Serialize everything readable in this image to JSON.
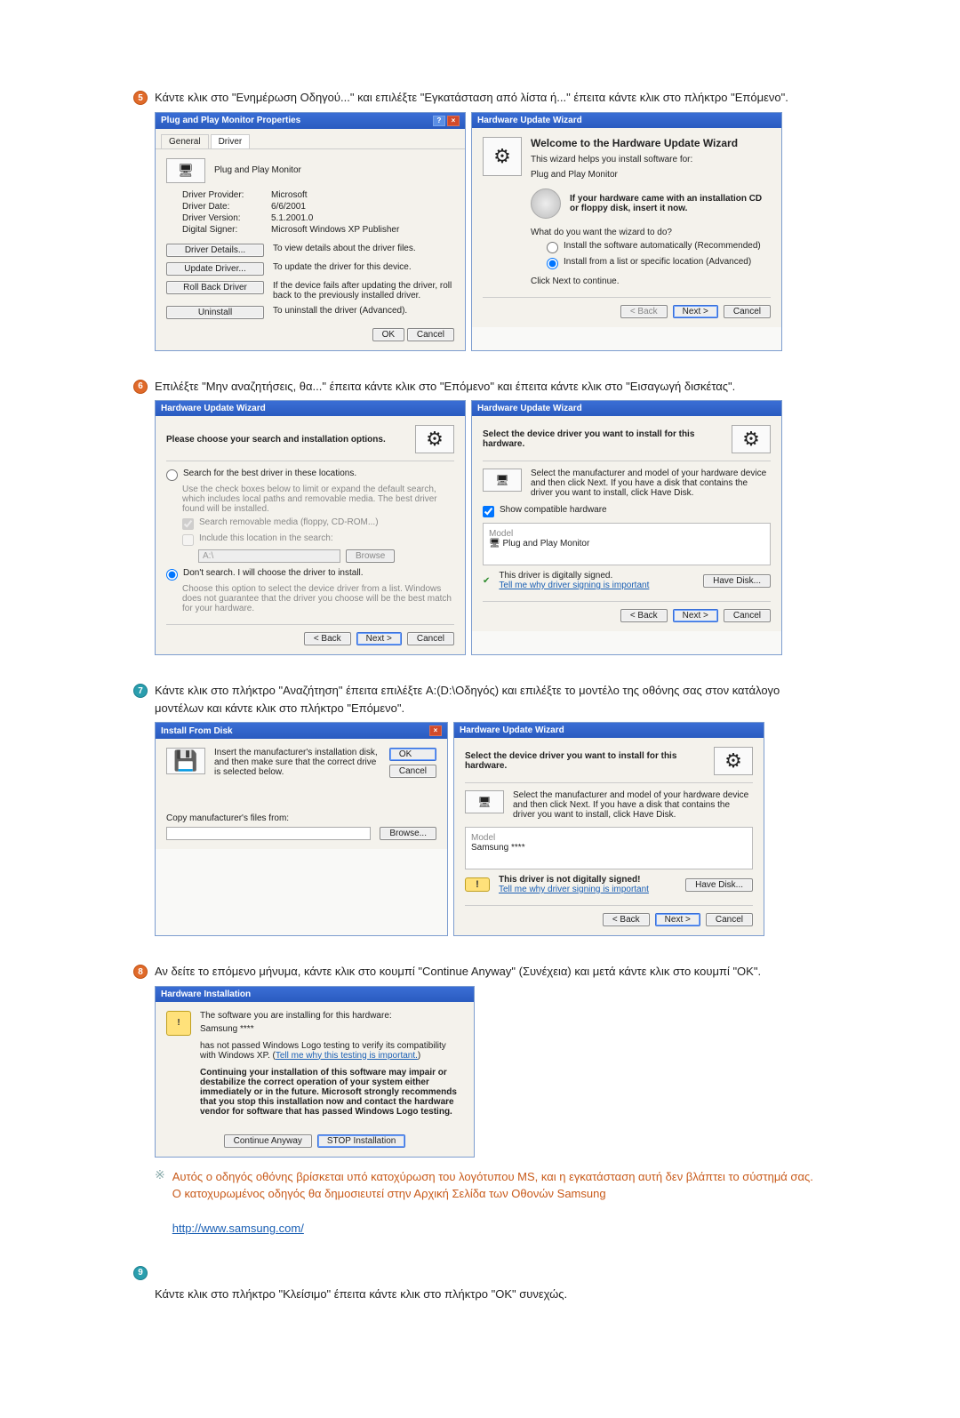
{
  "steps": {
    "s5": "Κάντε κλικ στο \"Ενημέρωση Οδηγού...\" και επιλέξτε \"Εγκατάσταση από λίστα ή...\" έπειτα κάντε κλικ στο πλήκτρο \"Επόμενο\".",
    "s6": "Επιλέξτε \"Μην αναζητήσεις, θα...\" έπειτα κάντε κλικ στο \"Επόμενο\" και έπειτα κάντε κλικ στο \"Εισαγωγή δισκέτας\".",
    "s7": "Κάντε κλικ στο πλήκτρο \"Αναζήτηση\" έπειτα επιλέξτε A:(D:\\Οδηγός) και επιλέξτε το μοντέλο της οθόνης σας στον κατάλογο μοντέλων και κάντε κλικ στο πλήκτρο \"Επόμενο\".",
    "s8": "Αν δείτε το επόμενο μήνυμα, κάντε κλικ στο κουμπί \"Continue Anyway\" (Συνέχεια) και μετά κάντε κλικ στο κουμπί \"OK\".",
    "note1": "Αυτός ο οδηγός οθόνης βρίσκεται υπό κατοχύρωση του λογότυπου MS, και η εγκατάσταση αυτή δεν βλάπτει το σύστημά σας.",
    "note2": "Ο κατοχυρωμένος οδηγός θα δημοσιευτεί στην Αρχική Σελίδα των Οθονών Samsung",
    "url": "http://www.samsung.com/",
    "s9": "Κάντε κλικ στο πλήκτρο \"Κλείσιμο\" έπειτα κάντε κλικ στο πλήκτρο \"ΟΚ\" συνεχώς."
  },
  "prop": {
    "title": "Plug and Play Monitor Properties",
    "tab_general": "General",
    "tab_driver": "Driver",
    "name": "Plug and Play Monitor",
    "provider_lbl": "Driver Provider:",
    "provider": "Microsoft",
    "date_lbl": "Driver Date:",
    "date": "6/6/2001",
    "version_lbl": "Driver Version:",
    "version": "5.1.2001.0",
    "signer_lbl": "Digital Signer:",
    "signer": "Microsoft Windows XP Publisher",
    "btn_details": "Driver Details...",
    "desc_details": "To view details about the driver files.",
    "btn_update": "Update Driver...",
    "desc_update": "To update the driver for this device.",
    "btn_rollback": "Roll Back Driver",
    "desc_rollback": "If the device fails after updating the driver, roll back to the previously installed driver.",
    "btn_uninstall": "Uninstall",
    "desc_uninstall": "To uninstall the driver (Advanced).",
    "ok": "OK",
    "cancel": "Cancel"
  },
  "wizwelcome": {
    "title": "Hardware Update Wizard",
    "heading": "Welcome to the Hardware Update Wizard",
    "intro": "This wizard helps you install software for:",
    "device": "Plug and Play Monitor",
    "cdline": "If your hardware came with an installation CD or floppy disk, insert it now.",
    "question": "What do you want the wizard to do?",
    "opt_auto": "Install the software automatically (Recommended)",
    "opt_list": "Install from a list or specific location (Advanced)",
    "cont": "Click Next to continue.",
    "back": "< Back",
    "next": "Next >",
    "cancel": "Cancel"
  },
  "wizsearch": {
    "title": "Hardware Update Wizard",
    "heading": "Please choose your search and installation options.",
    "opt_search": "Search for the best driver in these locations.",
    "search_desc": "Use the check boxes below to limit or expand the default search, which includes local paths and removable media. The best driver found will be installed.",
    "chk_media": "Search removable media (floppy, CD-ROM...)",
    "chk_location": "Include this location in the search:",
    "path": "A:\\",
    "browse": "Browse",
    "opt_dont": "Don't search. I will choose the driver to install.",
    "dont_desc": "Choose this option to select the device driver from a list. Windows does not guarantee that the driver you choose will be the best match for your hardware.",
    "back": "< Back",
    "next": "Next >",
    "cancel": "Cancel"
  },
  "wizselect": {
    "title": "Hardware Update Wizard",
    "heading": "Select the device driver you want to install for this hardware.",
    "desc": "Select the manufacturer and model of your hardware device and then click Next. If you have a disk that contains the driver you want to install, click Have Disk.",
    "chk_compat": "Show compatible hardware",
    "model_lbl": "Model",
    "model1": "Plug and Play Monitor",
    "signed": "This driver is digitally signed.",
    "signlink": "Tell me why driver signing is important",
    "havedisk": "Have Disk...",
    "back": "< Back",
    "next": "Next >",
    "cancel": "Cancel"
  },
  "installdisk": {
    "title": "Install From Disk",
    "instr": "Insert the manufacturer's installation disk, and then make sure that the correct drive is selected below.",
    "ok": "OK",
    "cancel": "Cancel",
    "copy_lbl": "Copy manufacturer's files from:",
    "browse": "Browse..."
  },
  "wizselect2": {
    "title": "Hardware Update Wizard",
    "heading": "Select the device driver you want to install for this hardware.",
    "desc": "Select the manufacturer and model of your hardware device and then click Next. If you have a disk that contains the driver you want to install, click Have Disk.",
    "model_lbl": "Model",
    "model1": "Samsung ****",
    "notsigned": "This driver is not digitally signed!",
    "signlink": "Tell me why driver signing is important",
    "havedisk": "Have Disk...",
    "back": "< Back",
    "next": "Next >",
    "cancel": "Cancel"
  },
  "hwinst": {
    "title": "Hardware Installation",
    "line1": "The software you are installing for this hardware:",
    "device": "Samsung ****",
    "line2a": "has not passed Windows Logo testing to verify its compatibility with Windows XP. (",
    "line2link": "Tell me why this testing is important.",
    "line2b": ")",
    "warn": "Continuing your installation of this software may impair or destabilize the correct operation of your system either immediately or in the future. Microsoft strongly recommends that you stop this installation now and contact the hardware vendor for software that has passed Windows Logo testing.",
    "cont": "Continue Anyway",
    "stop": "STOP Installation"
  }
}
